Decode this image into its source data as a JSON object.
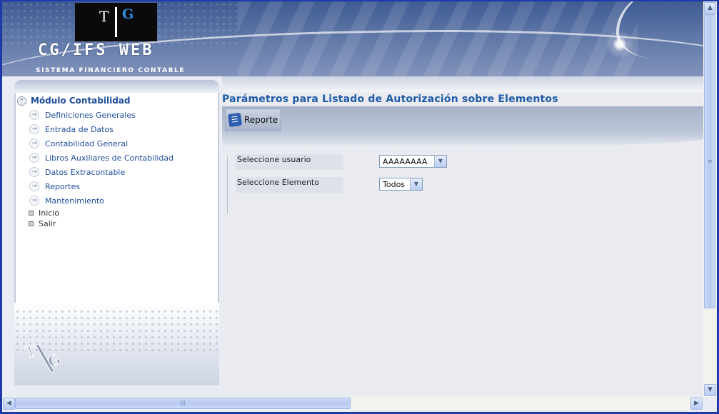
{
  "header": {
    "logo_left": "T",
    "logo_right": "G",
    "app_title": "CG/IFS WEB",
    "app_subtitle": "SISTEMA FINANCIERO CONTABLE"
  },
  "sidebar": {
    "module": {
      "label": "Módulo Contabilidad",
      "icon": "chevron-up-icon"
    },
    "items": [
      {
        "label": "Definiciones Generales",
        "icon": "arrow-right-icon"
      },
      {
        "label": "Entrada de Datos",
        "icon": "arrow-right-icon"
      },
      {
        "label": "Contabilidad General",
        "icon": "arrow-right-icon"
      },
      {
        "label": "Libros Auxiliares de Contabilidad",
        "icon": "arrow-right-icon"
      },
      {
        "label": "Datos Extracontable",
        "icon": "arrow-right-icon"
      },
      {
        "label": "Reportes",
        "icon": "arrow-right-icon"
      },
      {
        "label": "Mantenimiento",
        "icon": "arrow-right-icon"
      }
    ],
    "links": [
      {
        "label": "Inicio"
      },
      {
        "label": "Salir"
      }
    ],
    "footer_logo": "TG"
  },
  "main": {
    "page_title": "Parámetros para Listado de Autorización sobre Elementos",
    "toolbar": {
      "report_label": "Reporte",
      "report_icon": "report-icon"
    },
    "form": {
      "user_label": "Seleccione usuario",
      "user_value": "AAAAAAAA",
      "element_label": "Seleccione Elemento",
      "element_value": "Todos"
    }
  },
  "colors": {
    "frame_border": "#1e3aa8",
    "accent_text": "#1e5aa8",
    "nav_text": "#1e4d9b",
    "header_bg": "#4f6aa0"
  }
}
